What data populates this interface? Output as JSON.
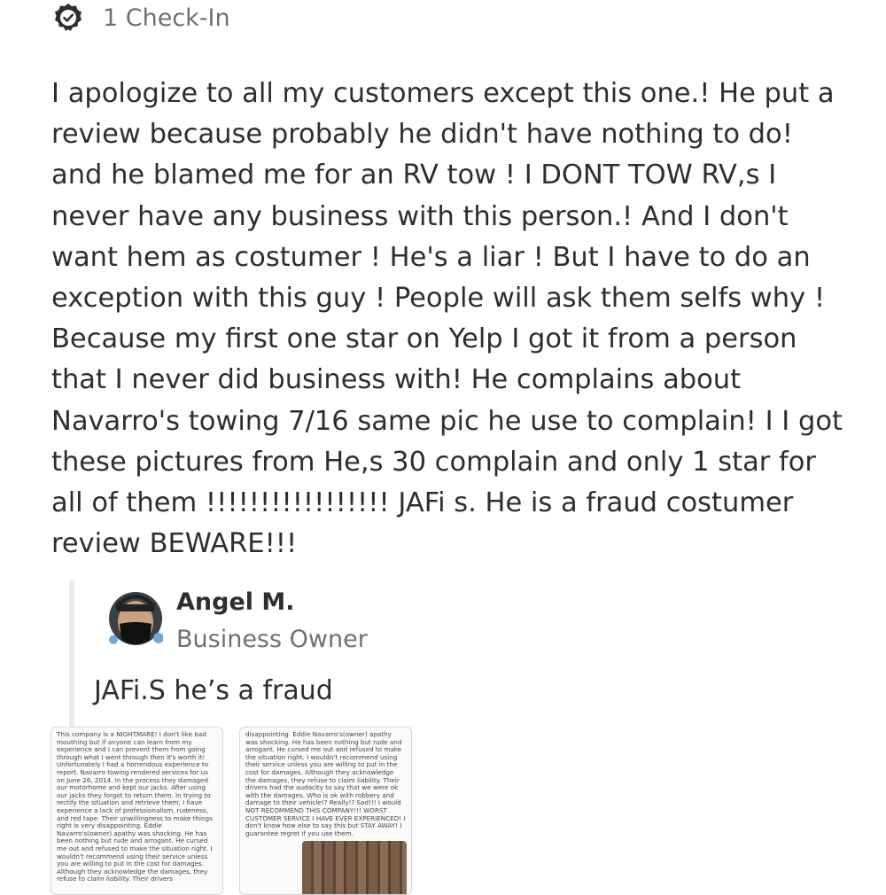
{
  "checkin": {
    "icon": "checkin-badge-icon",
    "label": "1 Check-In"
  },
  "review": {
    "text": "I apologize to  all my customers  except this one.! He put a review because probably he didn't have nothing to do! and he blamed me for an RV tow !  I DONT TOW RV,s  I never have any business with this person.! And I don't want hem as costumer ! He's a liar ! But I have to do an exception with this guy ! People will ask them selfs  why ! Because my first one star on  Yelp  I got it from a person that I never did business with! He complains about Navarro's towing  7/16 same pic he use to complain! I I got these pictures from He,s 30 complain and only 1 star for all of them !!!!!!!!!!!!!!!!! JAFi s. He is a fraud costumer review BEWARE!!!"
  },
  "owner_reply": {
    "name": "Angel M.",
    "role": "Business Owner",
    "text": "JAFi.S  he’s a fraud",
    "avatar_icon": "user-avatar-icon"
  },
  "screenshots": [
    {
      "text": "This company is a NIGHTMARE! I don't like bad mouthing but if anyone can learn from my experience and I can prevent them from going through what I went through then it's worth it! Unfortunately I had a horrendous experience to report. Navarro towing rendered services for us on June 26, 2014. In the process they damaged our motorhome and kept our jacks. After using our jacks they forgot to return them. In trying to rectify the situation and retrieve them, I have experience a lack of professionalism, rudeness, and red tape. Their unwillingness to make things right is very disappointing. Eddie Navarro's(owner) apathy was shocking. He has been nothing but rude and arrogant. He cursed me out and refused to make the situation right. I wouldn't recommend using their service unless you are willing to put in the cost for damages. Although they acknowledge the damages, they refuse to claim liability. Their drivers"
    },
    {
      "text": "disappointing. Eddie Navarro's(owner) apathy was shocking. He has been nothing but rude and arrogant. He cursed me out and refused to make the situation right. I wouldn't recommend using their service unless you are willing to put in the cost for damages. Although they acknowledge the damages, they refuse to claim liability. Their drivers had the audacity to say that we were ok with the damages. Who is ok with robbery and damage to their vehicle!? Really!? Sad!!! I would NOT RECOMMEND THIS COMPANY!!! WORST CUSTOMER SERVICE I HAVE EVER EXPERIENCED! I don't know how else to say this but STAY AWAY! I guarantee regret if you use them."
    }
  ],
  "colors": {
    "text": "#2d2e2f",
    "muted": "#6e7072",
    "reply_bar": "#ebebeb"
  }
}
